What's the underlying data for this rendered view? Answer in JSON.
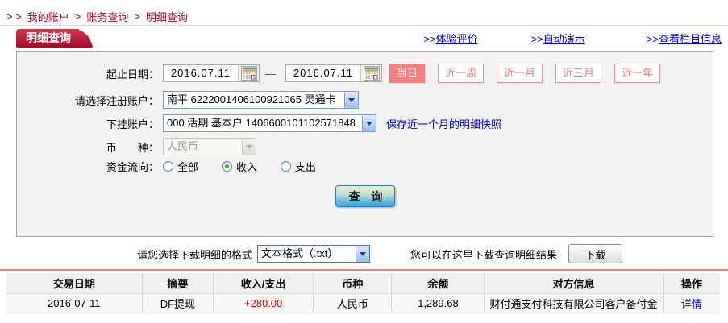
{
  "colors": {
    "brand_red": "#a50a2a",
    "salmon": "#f58080",
    "link_blue": "#0000cc",
    "amount_red": "#cc0000"
  },
  "breadcrumb": {
    "prefix": "> >",
    "separator": ">",
    "items": [
      "我的账户",
      "账务查询",
      "明细查询"
    ]
  },
  "topbar": {
    "tab": "明细查询",
    "links": [
      {
        "prefix": ">>",
        "label": "体验评价"
      },
      {
        "prefix": ">>",
        "label": "自动演示"
      },
      {
        "prefix": ">>",
        "label": "查看栏目信息"
      }
    ]
  },
  "form": {
    "date_range": {
      "label": "起止日期：",
      "from": "2016.07.11",
      "separator": "—",
      "to": "2016.07.11"
    },
    "quick_ranges": [
      {
        "label": "当日",
        "active": true
      },
      {
        "label": "近一周",
        "active": false
      },
      {
        "label": "近一月",
        "active": false
      },
      {
        "label": "近三月",
        "active": false
      },
      {
        "label": "近一年",
        "active": false
      }
    ],
    "registered_account": {
      "label": "请选择注册账户：",
      "value": "南平  6222001406100921065  灵通卡"
    },
    "sub_account": {
      "label": "下挂账户：",
      "value": "000 活期 基本户  1406600101102571848",
      "snapshot_link": "保存近一个月的明细快照"
    },
    "currency": {
      "label": "币　　种：",
      "value": "人民币",
      "disabled": true
    },
    "flow": {
      "label": "资金流向：",
      "options": [
        {
          "label": "全部",
          "selected": false
        },
        {
          "label": "收入",
          "selected": true
        },
        {
          "label": "支出",
          "selected": false
        }
      ]
    },
    "query_button": "查 询"
  },
  "download": {
    "format_label": "请您选择下载明细的格式",
    "format_value": "文本格式（.txt）",
    "hint": "您可以在这里下载查询明细结果",
    "button": "下载"
  },
  "table": {
    "headers": [
      "交易日期",
      "摘要",
      "收入/支出",
      "币种",
      "余额",
      "对方信息",
      "操作"
    ],
    "rows": [
      {
        "date": "2016-07-11",
        "summary": "DF提现",
        "amount": "+280.00",
        "currency": "人民币",
        "balance": "1,289.68",
        "counterparty": "财付通支付科技有限公司客户备付金",
        "action": "详情"
      }
    ]
  }
}
